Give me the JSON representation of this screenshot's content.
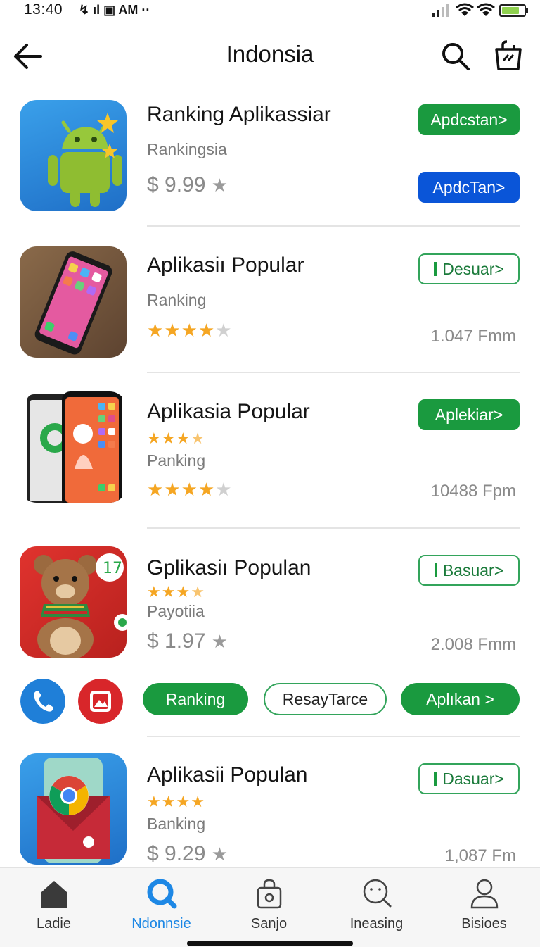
{
  "status_bar": {
    "time": "13:40",
    "left_icons": "↯ ıl ▣ AM ··",
    "battery_level": 0.8
  },
  "header": {
    "title": "Indonsia",
    "back_icon": "arrow-left-icon",
    "search_icon": "search-icon",
    "cart_icon": "shopping-bag-icon"
  },
  "apps": [
    {
      "title": "Ranking  Aplikassiar",
      "subtitle": "Rankingsia",
      "price": "$ 9.99",
      "price_star": "★",
      "button": "Apdcstan>",
      "button2": "ApdcTan>"
    },
    {
      "title": "Aplikasiı Popular",
      "subtitle": "Ranking",
      "stars": "★★★★★",
      "rating": 4,
      "button": "Desuar>",
      "count": "1.047 Fmm"
    },
    {
      "title": "Aplikasia Popular",
      "stars_small": "★★★★",
      "rating_small": 3.5,
      "subtitle": "Panking",
      "stars": "★★★★★",
      "rating": 4,
      "button": "Aplekiar>",
      "count": "10488 Fpm"
    },
    {
      "title": "Gplikasiı Populan",
      "stars_small": "★★★★",
      "rating_small": 3.5,
      "subtitle": "Payotiia",
      "price": "$ 1.97",
      "price_star": "★",
      "button": "Basuar>",
      "count": "2.008 Fmm"
    },
    {
      "title": "Aplikasii Populan",
      "stars_small": "★★★★",
      "rating_small": 4,
      "subtitle": "Banking",
      "price": "$ 9.29",
      "price_star": "★",
      "button": "Dasuar>",
      "count": "1,087 Fm"
    }
  ],
  "chips": {
    "ranking": "Ranking",
    "resay": "ResayTarce",
    "aplikan": "Aplıkan >"
  },
  "bottom_nav": [
    {
      "label": "Ladie",
      "icon": "home-icon"
    },
    {
      "label": "Ndonnsie",
      "icon": "search-icon",
      "active": true
    },
    {
      "label": "Sanjo",
      "icon": "bag-icon"
    },
    {
      "label": "Ineasing",
      "icon": "search-face-icon"
    },
    {
      "label": "Bisioes",
      "icon": "person-icon"
    }
  ],
  "colors": {
    "green": "#1a9a3f",
    "blue": "#0a55d8",
    "star": "#f5a623",
    "active_nav": "#1e88e5"
  }
}
